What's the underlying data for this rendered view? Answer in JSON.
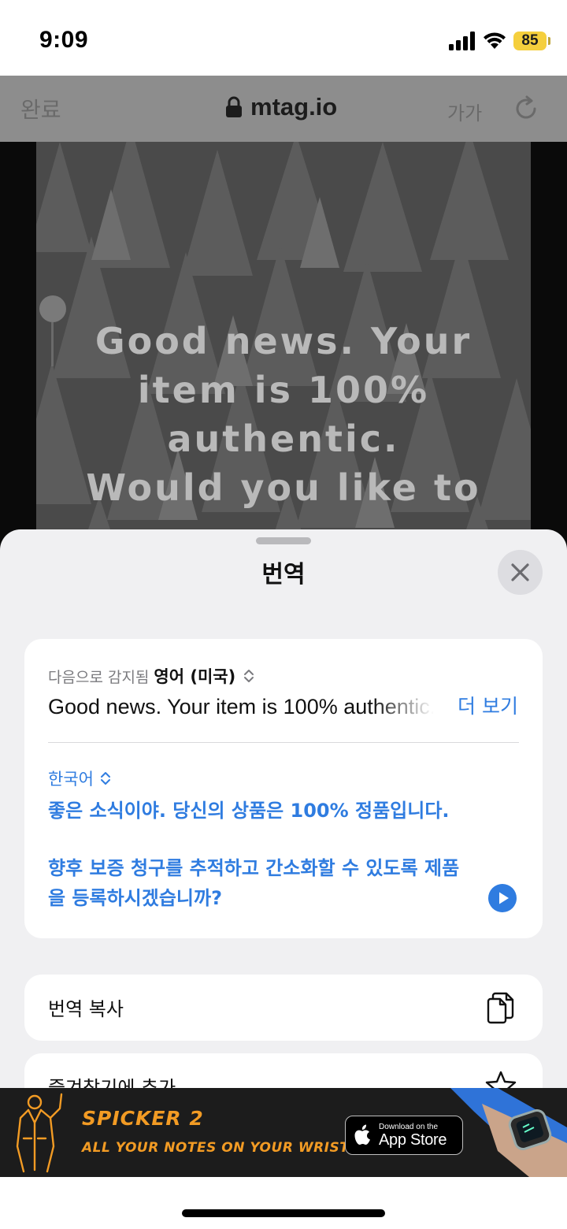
{
  "status_bar": {
    "time": "9:09",
    "battery": "85"
  },
  "browser": {
    "done": "완료",
    "url": "mtag.io",
    "text_size": "가가"
  },
  "webpage": {
    "headline": "Good news. Your item is 100% authentic.",
    "subheadline": "Would you like to"
  },
  "translate_sheet": {
    "title": "번역",
    "detected_label": "다음으로 감지됨",
    "detected_language": "영어 (미국)",
    "source_text": "Good news. Your item is 100% authentic.",
    "more": "더 보기",
    "target_language": "한국어",
    "translation_line_1": "좋은 소식이야. 당신의 상품은 100% 정품입니다.",
    "translation_line_2": "향후 보증 청구를 추적하고 간소화할 수 있도록 제품을 등록하시겠습니까?",
    "actions": [
      {
        "label": "번역 복사",
        "icon": "copy-icon"
      },
      {
        "label": "즐겨찾기에 추가",
        "icon": "star-icon"
      }
    ]
  },
  "ad": {
    "title": "SPICKER 2",
    "tagline": "ALL YOUR NOTES ON YOUR WRIST",
    "badge_small": "Download on the",
    "badge_big": "App Store"
  }
}
